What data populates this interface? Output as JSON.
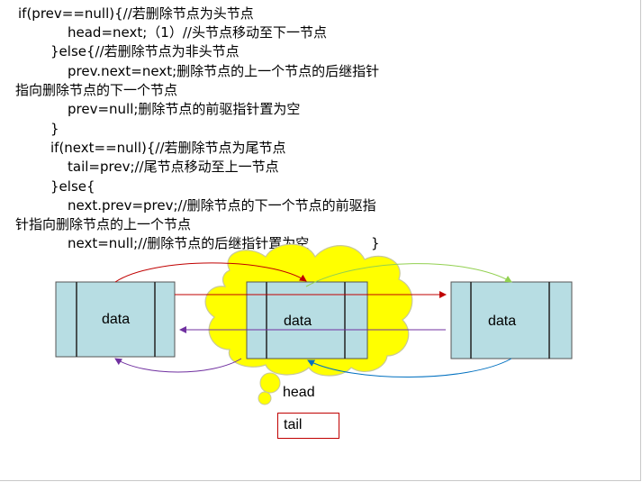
{
  "code": {
    "line1": "if(prev==null){//若删除节点为头节点",
    "line2": "head=next;（1）//头节点移动至下一节点",
    "line3": "}else{//若删除节点为非头节点",
    "line4": "prev.next=next;删除节点的上一个节点的后继指针",
    "line5": "指向删除节点的下一个节点",
    "line6": "prev=null;删除节点的前驱指针置为空",
    "line7": "}",
    "line8": "if(next==null){//若删除节点为尾节点",
    "line9": "tail=prev;//尾节点移动至上一节点",
    "line10": "}else{",
    "line11": "next.prev=prev;//删除节点的下一个节点的前驱指",
    "line12": "针指向删除节点的上一个节点",
    "line13": "next=null;//删除节点的后继指针置为空",
    "line13_brace": "}"
  },
  "diagram": {
    "node_left_label": "data",
    "node_middle_label": "data",
    "node_right_label": "data",
    "head_label": "head",
    "tail_label": "tail",
    "colors": {
      "node_fill": "#b7dde3",
      "node_border": "#555555",
      "cloud_fill": "#ffff00",
      "cloud_border": "#c0c0a0",
      "arrow_red": "#c00000",
      "arrow_purple": "#7030a0",
      "arrow_green": "#92d050",
      "arrow_blue": "#0070c0"
    }
  }
}
